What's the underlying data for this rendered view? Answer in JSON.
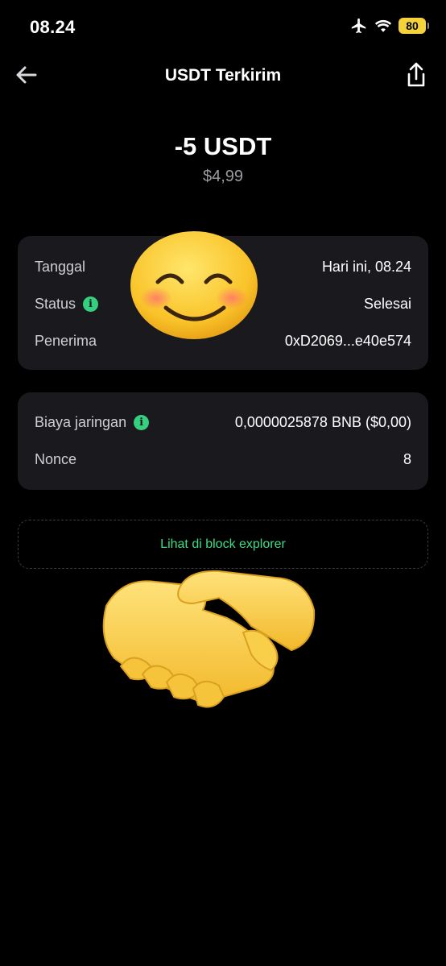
{
  "status_bar": {
    "time": "08.24",
    "battery": "80",
    "icons": [
      "airplane-icon",
      "wifi-icon",
      "battery-icon"
    ]
  },
  "header": {
    "title": "USDT Terkirim",
    "back_icon": "arrow-left-icon",
    "share_icon": "share-icon"
  },
  "amount": {
    "crypto": "-5 USDT",
    "fiat": "$4,99"
  },
  "details": {
    "date_label": "Tanggal",
    "date_value": "Hari ini, 08.24",
    "status_label": "Status",
    "status_value": "Selesai",
    "recipient_label": "Penerima",
    "recipient_value": "0xD2069...e40e574"
  },
  "fees": {
    "fee_label": "Biaya jaringan",
    "fee_value": "0,0000025878 BNB ($0,00)",
    "nonce_label": "Nonce",
    "nonce_value": "8"
  },
  "explorer": {
    "label": "Lihat di block explorer"
  },
  "colors": {
    "background": "#000000",
    "card": "#1a1a1e",
    "accent_green": "#3ddc84",
    "muted_text": "#9b9ba1",
    "battery_yellow": "#f3d23b"
  },
  "stickers": [
    "smiling-face-emoji",
    "handshake-emoji"
  ]
}
